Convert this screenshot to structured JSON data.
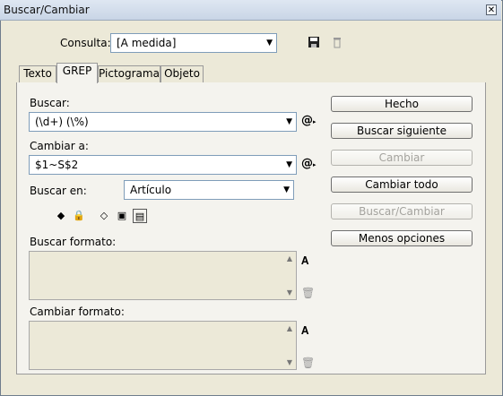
{
  "window": {
    "title": "Buscar/Cambiar",
    "close_glyph": "✕"
  },
  "query": {
    "label": "Consulta:",
    "value": "[A medida]"
  },
  "tabs": [
    {
      "label": "Texto"
    },
    {
      "label": "GREP"
    },
    {
      "label": "Pictograma"
    },
    {
      "label": "Objeto"
    }
  ],
  "find": {
    "label": "Buscar:",
    "value": "(\\d+) (\\%)"
  },
  "change": {
    "label": "Cambiar a:",
    "value": "$1~S$2"
  },
  "search_in": {
    "label": "Buscar en:",
    "value": "Artículo"
  },
  "find_format": {
    "label": "Buscar formato:"
  },
  "change_format": {
    "label": "Cambiar formato:"
  },
  "buttons": {
    "done": "Hecho",
    "find_next": "Buscar siguiente",
    "change": "Cambiar",
    "change_all": "Cambiar todo",
    "find_change": "Buscar/Cambiar",
    "fewer_options": "Menos opciones"
  },
  "icons": {
    "save_query": "save-icon",
    "delete_query": "trash-icon",
    "special_chars": "at-menu-icon",
    "specify_format": "format-icon"
  }
}
